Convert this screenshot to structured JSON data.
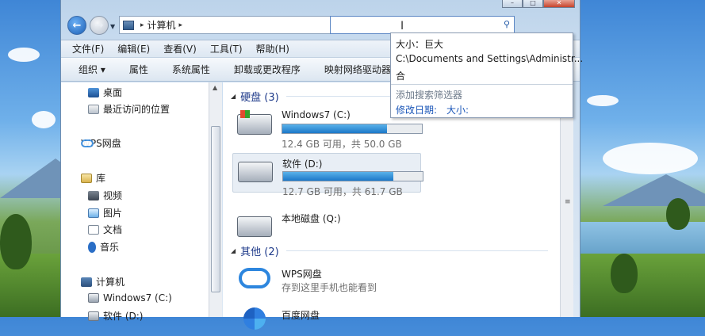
{
  "address": {
    "path": "计算机"
  },
  "menu": [
    "文件(F)",
    "编辑(E)",
    "查看(V)",
    "工具(T)",
    "帮助(H)"
  ],
  "toolbar": [
    "组织 ▾",
    "属性",
    "系统属性",
    "卸载或更改程序",
    "映射网络驱动器"
  ],
  "nav": {
    "desktop": "桌面",
    "recent": "最近访问的位置",
    "wps": "WPS网盘",
    "library": "库",
    "video": "视频",
    "pictures": "图片",
    "docs": "文档",
    "music": "音乐",
    "computer": "计算机",
    "c_drive": "Windows7 (C:)",
    "d_drive": "软件 (D:)"
  },
  "groups": {
    "hdd": "硬盘 (3)",
    "other": "其他 (2)"
  },
  "drives": [
    {
      "name": "Windows7 (C:)",
      "info": "12.4 GB 可用，共 50.0 GB",
      "used_fraction": 0.75
    },
    {
      "name": "软件 (D:)",
      "info": "12.7 GB 可用，共 61.7 GB",
      "used_fraction": 0.79
    },
    {
      "name": "本地磁盘 (Q:)"
    }
  ],
  "other": [
    {
      "name": "WPS网盘",
      "desc": "存到这里手机也能看到"
    },
    {
      "name": "百度网盘"
    }
  ],
  "dropdown": {
    "line1": "大小：巨大",
    "line2": "C:\\Documents and Settings\\Administr...",
    "line3": "合",
    "hint": "添加搜索筛选器",
    "filter_date": "修改日期:",
    "filter_size": "大小:"
  }
}
